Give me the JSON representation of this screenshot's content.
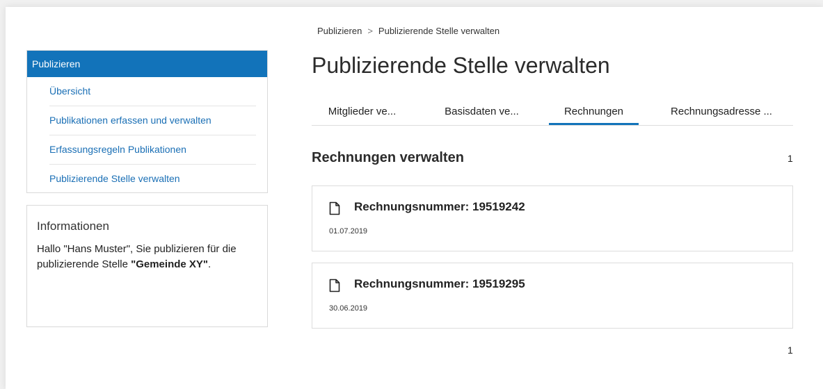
{
  "breadcrumb": {
    "items": [
      "Publizieren",
      "Publizierende Stelle verwalten"
    ],
    "separator": ">"
  },
  "sidebar": {
    "nav_header": "Publizieren",
    "items": [
      {
        "label": "Übersicht"
      },
      {
        "label": "Publikationen erfassen und verwalten"
      },
      {
        "label": "Erfassungsregeln Publikationen"
      },
      {
        "label": "Publizierende Stelle verwalten"
      }
    ],
    "info": {
      "title": "Informationen",
      "text_prefix": "Hallo \"Hans Muster\", Sie publizieren für die publizierende Stelle ",
      "org_name": "\"Gemeinde XY\"",
      "text_suffix": "."
    }
  },
  "main": {
    "title": "Publizierende Stelle verwalten",
    "tabs": [
      {
        "label": "Mitglieder ve..."
      },
      {
        "label": "Basisdaten ve..."
      },
      {
        "label": "Rechnungen",
        "active": true
      },
      {
        "label": "Rechnungsadresse ..."
      }
    ],
    "section_title": "Rechnungen verwalten",
    "page_top": "1",
    "page_bottom": "1",
    "invoices": [
      {
        "title": "Rechnungsnummer: 19519242",
        "date": "01.07.2019",
        "icon": "document-icon"
      },
      {
        "title": "Rechnungsnummer: 19519295",
        "date": "30.06.2019",
        "icon": "document-icon"
      }
    ]
  },
  "colors": {
    "accent": "#1273ba",
    "link": "#1a6fb5",
    "border": "#dcdcdc",
    "background": "#f1f1f1"
  }
}
